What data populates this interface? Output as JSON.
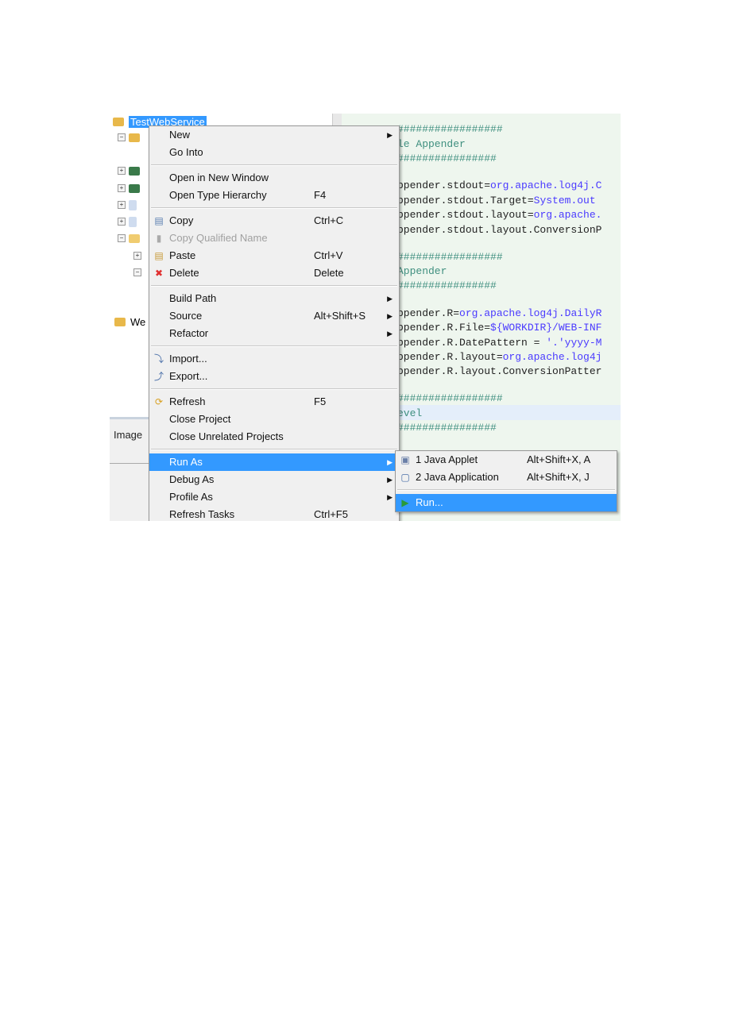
{
  "tree": {
    "selected": "TestWebService",
    "partial_item": "We"
  },
  "lower_pane": {
    "tab": "Image"
  },
  "editor": {
    "lines": [
      {
        "t": "comment",
        "text": "#################"
      },
      {
        "t": "comment",
        "text": "le Appender"
      },
      {
        "t": "comment",
        "text": "################"
      },
      {
        "t": "blank",
        "text": ""
      },
      {
        "t": "kv",
        "key": "ppender.stdout=",
        "val": "org.apache.log4j.C"
      },
      {
        "t": "kv",
        "key": "ppender.stdout.Target=",
        "val": "System.out"
      },
      {
        "t": "kv",
        "key": "ppender.stdout.layout=",
        "val": "org.apache."
      },
      {
        "t": "kv",
        "key": "ppender.stdout.layout.ConversionP",
        "val": ""
      },
      {
        "t": "blank",
        "text": ""
      },
      {
        "t": "comment",
        "text": "#################"
      },
      {
        "t": "comment",
        "text": "Appender"
      },
      {
        "t": "comment",
        "text": "################"
      },
      {
        "t": "blank",
        "text": ""
      },
      {
        "t": "kv",
        "key": "ppender.R=",
        "val": "org.apache.log4j.DailyR"
      },
      {
        "t": "kv",
        "key": "ppender.R.File=",
        "val": "${WORKDIR}/WEB-INF"
      },
      {
        "t": "kv",
        "key": "ppender.R.DatePattern = ",
        "val": "'.'yyyy-M"
      },
      {
        "t": "kv",
        "key": "ppender.R.layout=",
        "val": "org.apache.log4j"
      },
      {
        "t": "kv",
        "key": "ppender.R.layout.ConversionPatter",
        "val": ""
      },
      {
        "t": "blank",
        "text": ""
      },
      {
        "t": "comment",
        "text": "#################"
      },
      {
        "t": "comment",
        "text": "evel"
      },
      {
        "t": "comment",
        "text": "################"
      }
    ]
  },
  "context_menu": {
    "items": [
      {
        "label": "New",
        "submenu": true
      },
      {
        "label": "Go Into"
      },
      {
        "sep": true
      },
      {
        "label": "Open in New Window"
      },
      {
        "label": "Open Type Hierarchy",
        "shortcut": "F4"
      },
      {
        "sep": true
      },
      {
        "label": "Copy",
        "shortcut": "Ctrl+C",
        "icon": "copy-icon"
      },
      {
        "label": "Copy Qualified Name",
        "disabled": true,
        "icon": "copy-qualified-icon"
      },
      {
        "label": "Paste",
        "shortcut": "Ctrl+V",
        "icon": "paste-icon"
      },
      {
        "label": "Delete",
        "shortcut": "Delete",
        "icon": "delete-icon"
      },
      {
        "sep": true
      },
      {
        "label": "Build Path",
        "submenu": true
      },
      {
        "label": "Source",
        "shortcut": "Alt+Shift+S",
        "submenu": true
      },
      {
        "label": "Refactor",
        "submenu": true
      },
      {
        "sep": true
      },
      {
        "label": "Import...",
        "icon": "import-icon"
      },
      {
        "label": "Export...",
        "icon": "export-icon"
      },
      {
        "sep": true
      },
      {
        "label": "Refresh",
        "shortcut": "F5",
        "icon": "refresh-icon"
      },
      {
        "label": "Close Project"
      },
      {
        "label": "Close Unrelated Projects"
      },
      {
        "sep": true
      },
      {
        "label": "Run As",
        "submenu": true,
        "highlighted": true
      },
      {
        "label": "Debug As",
        "submenu": true
      },
      {
        "label": "Profile As",
        "submenu": true
      },
      {
        "label": "Refresh Tasks",
        "shortcut": "Ctrl+F5"
      }
    ]
  },
  "run_as_submenu": {
    "items": [
      {
        "label": "1 Java Applet",
        "shortcut": "Alt+Shift+X, A",
        "icon": "java-applet-icon"
      },
      {
        "label": "2 Java Application",
        "shortcut": "Alt+Shift+X, J",
        "icon": "java-application-icon"
      },
      {
        "sep": true
      },
      {
        "label": "Run...",
        "highlighted": true,
        "icon": "run-icon"
      }
    ]
  },
  "colors": {
    "highlight": "#3399ff",
    "editor_bg": "#eef6ee",
    "comment": "#3f8f7f",
    "value": "#4a3aff"
  }
}
